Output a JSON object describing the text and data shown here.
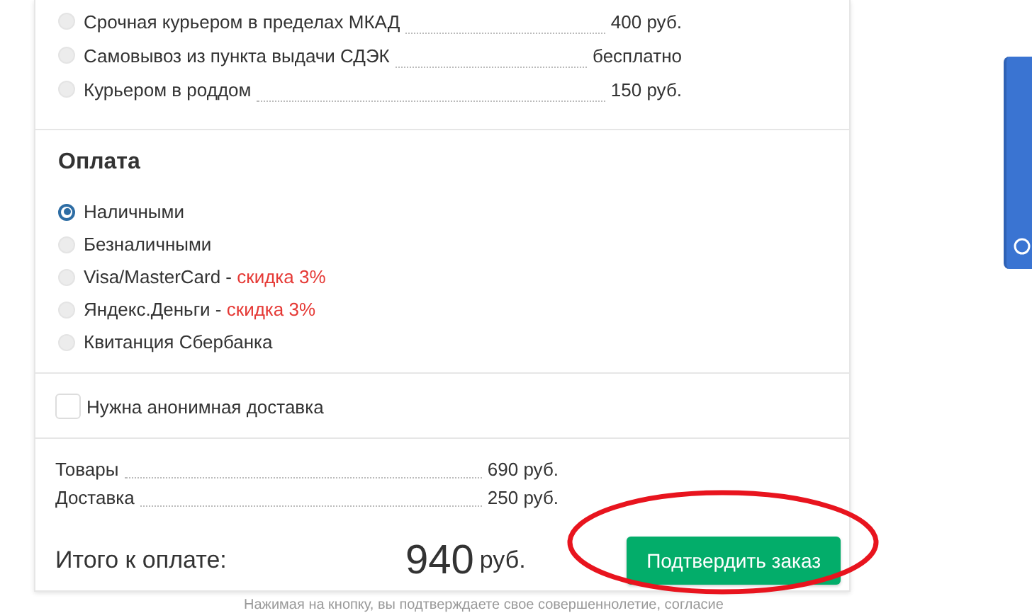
{
  "delivery": [
    {
      "label": "Срочная курьером в пределах МКАД",
      "price": "400 руб.",
      "selected": false
    },
    {
      "label": "Самовывоз из пункта выдачи СДЭК",
      "price": "бесплатно",
      "selected": false
    },
    {
      "label": "Курьером в роддом",
      "price": "150 руб.",
      "selected": false
    }
  ],
  "payment": {
    "title": "Оплата",
    "options": [
      {
        "label": "Наличными",
        "selected": true
      },
      {
        "label": "Безналичными",
        "selected": false
      },
      {
        "label": "Visa/MasterCard -",
        "discount": "скидка 3%",
        "selected": false
      },
      {
        "label": "Яндекс.Деньги -",
        "discount": "скидка 3%",
        "selected": false
      },
      {
        "label": "Квитанция Сбербанка",
        "selected": false
      }
    ]
  },
  "anonymous": {
    "label": "Нужна анонимная доставка",
    "checked": false
  },
  "summary": [
    {
      "label": "Товары",
      "value": "690 руб."
    },
    {
      "label": "Доставка",
      "value": "250 руб."
    }
  ],
  "total": {
    "label": "Итого к оплате:",
    "amount": "940",
    "currency": "руб."
  },
  "confirm_button": "Подтвердить заказ",
  "note": "Нажимая на кнопку, вы подтверждаете свое совершеннолетие, согласие"
}
